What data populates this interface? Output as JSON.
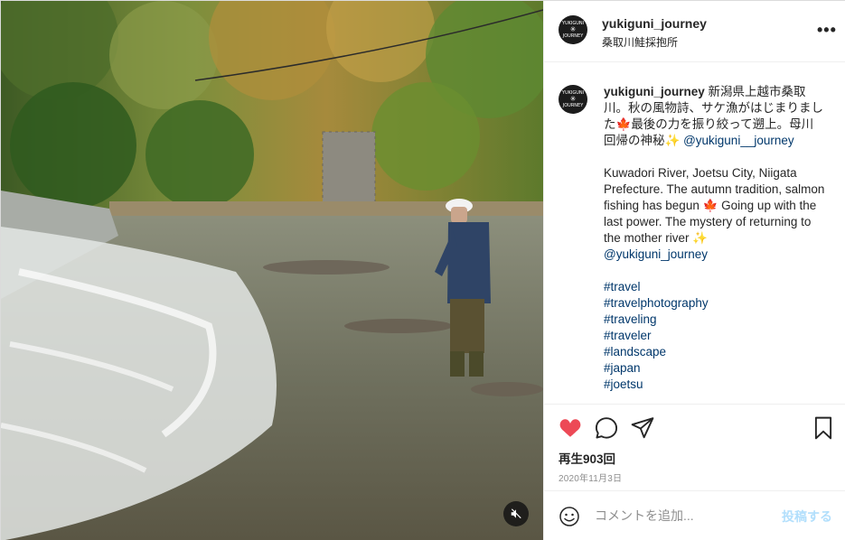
{
  "post": {
    "username": "yukiguni_journey",
    "location": "桑取川鮭採抱所",
    "avatar_text_top": "YUKIGUNI",
    "avatar_text_bottom": "JOURNEY",
    "avatar_flake": "✳",
    "more_label": "•••"
  },
  "caption": {
    "username": "yukiguni_journey",
    "jp_text_1": " 新潟県上越市桑取川。秋の風物詩、サケ漁がはじまりました",
    "jp_emoji_1": "🍁",
    "jp_text_2": "最後の力を振り絞って遡上。母川回帰の神秘",
    "jp_emoji_2": "✨",
    "jp_mention": "@yukiguni__journey",
    "en_text_1": "Kuwadori River, Joetsu City, Niigata Prefecture. The autumn tradition, salmon fishing has begun ",
    "en_emoji_1": "🍁",
    "en_text_2": " Going up with the last power. The mystery of returning to the mother river ",
    "en_emoji_2": "✨",
    "en_mention": "@yukiguni_journey",
    "hashtags": [
      "#travel",
      "#travelphotography",
      "#traveling",
      "#traveler",
      "#landscape",
      "#japan",
      "#joetsu"
    ]
  },
  "actions": {
    "icons": [
      "heart-icon",
      "comment-icon",
      "share-icon",
      "bookmark-icon"
    ],
    "liked_color": "#ed4956",
    "views": "再生903回",
    "date": "2020年11月3日"
  },
  "comment": {
    "placeholder": "コメントを追加...",
    "post_label": "投稿する",
    "post_color": "#b2dffc"
  },
  "video": {
    "mute_icon": "muted-speaker-icon"
  }
}
